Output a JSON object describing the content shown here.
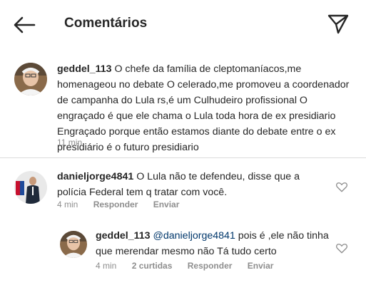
{
  "header": {
    "title": "Comentários",
    "back_icon": "arrow-left-icon",
    "send_icon": "paper-plane-icon"
  },
  "caption": {
    "username": "geddel_113",
    "text": "O chefe da família de cleptomaníacos,me homenageou no debate O celerado,me promoveu a coordenador de campanha do Lula rs,é um Culhudeiro profissional O engraçado é que ele chama o Lula toda hora de ex presidiario Engraçado porque então estamos diante do debate entre o ex presidiário é o futuro presidiario",
    "time": "11 min"
  },
  "comments": [
    {
      "username": "danieljorge4841",
      "text": "O Lula não te defendeu, disse que a polícia Federal tem q tratar com você.",
      "time": "4 min",
      "reply_label": "Responder",
      "send_label": "Enviar"
    }
  ],
  "reply": {
    "username": "geddel_113",
    "mention": "@danieljorge4841",
    "text": "pois é ,ele não tinha que merendar mesmo não Tá tudo certo",
    "time": "4 min",
    "likes": "2 curtidas",
    "reply_label": "Responder",
    "send_label": "Enviar"
  }
}
